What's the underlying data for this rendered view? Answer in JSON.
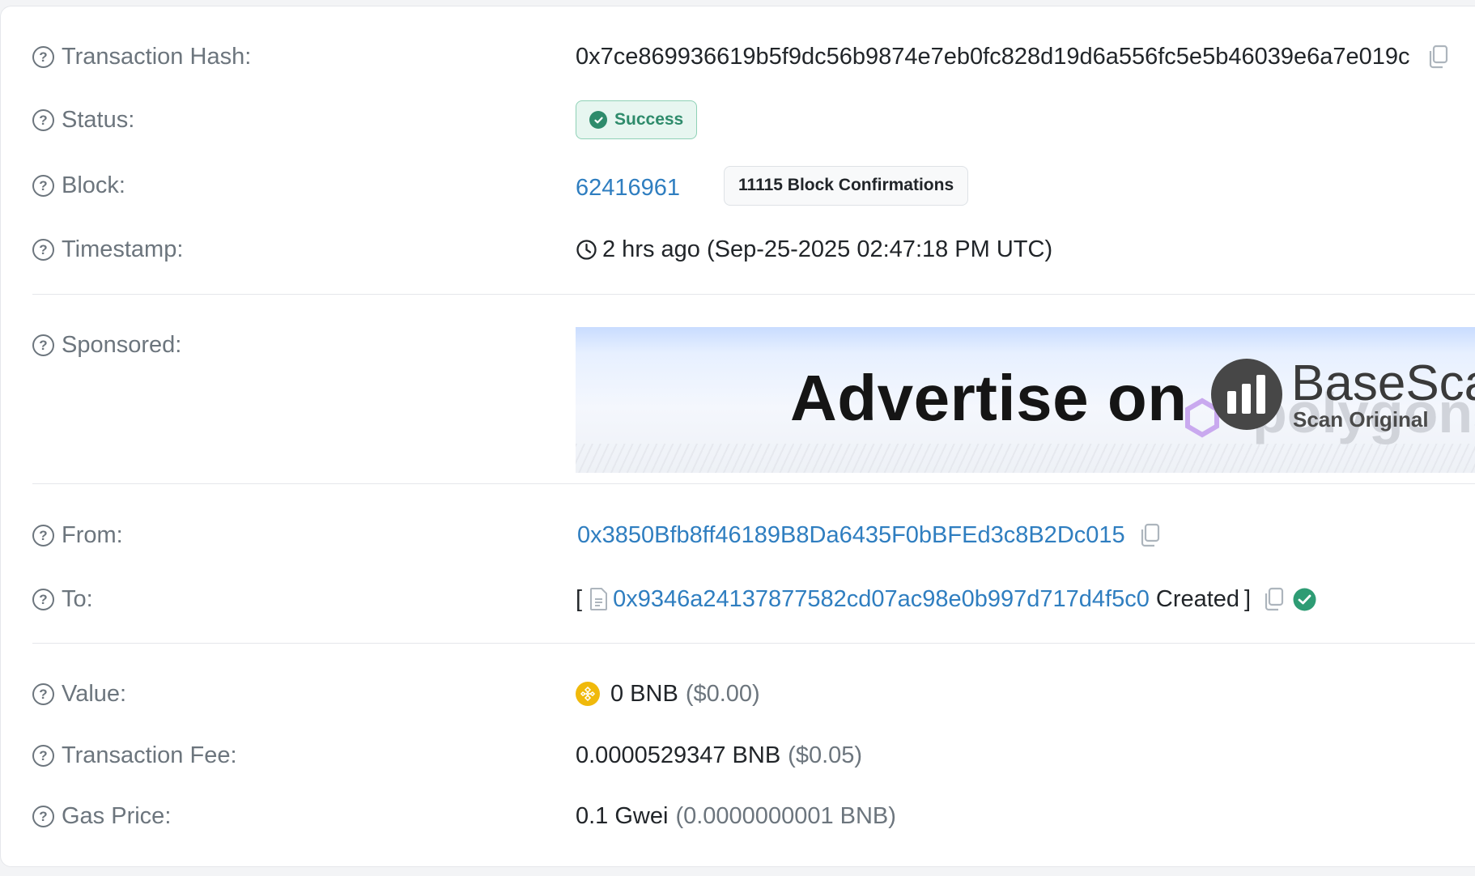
{
  "rows": {
    "tx_hash": {
      "label": "Transaction Hash:",
      "value": "0x7ce869936619b5f9dc56b9874e7eb0fc828d19d6a556fc5e5b46039e6a7e019c"
    },
    "status": {
      "label": "Status:",
      "value": "Success"
    },
    "block": {
      "label": "Block:",
      "number": "62416961",
      "confirmations": "11115 Block Confirmations"
    },
    "timestamp": {
      "label": "Timestamp:",
      "value": "2 hrs ago (Sep-25-2025 02:47:18 PM UTC)"
    },
    "sponsored": {
      "label": "Sponsored:",
      "ad_text": "Advertise on",
      "ad_brand": "BaseSca",
      "ad_brand_sub": "Scan Original",
      "ad_ghost": "polygons"
    },
    "from": {
      "label": "From:",
      "address": "0x3850Bfb8ff46189B8Da6435F0bBFEd3c8B2Dc015"
    },
    "to": {
      "label": "To:",
      "open_bracket": "[",
      "address": "0x9346a24137877582cd07ac98e0b997d717d4f5c0",
      "created": "Created",
      "close_bracket": "]"
    },
    "value": {
      "label": "Value:",
      "amount": "0 BNB",
      "usd": "($0.00)"
    },
    "fee": {
      "label": "Transaction Fee:",
      "amount": "0.0000529347 BNB",
      "usd": "($0.05)"
    },
    "gas_price": {
      "label": "Gas Price:",
      "amount": "0.1 Gwei",
      "detail": "(0.0000000001 BNB)"
    }
  },
  "icons": {
    "help": "question-circle-icon",
    "copy": "copy-icon",
    "check": "check-circle-icon",
    "clock": "clock-icon",
    "contract": "contract-file-icon",
    "bnb": "bnb-coin-icon"
  },
  "colors": {
    "link": "#2f7ec0",
    "success": "#2e8b6b",
    "bnb": "#f0b90b",
    "label": "#6c757d"
  }
}
